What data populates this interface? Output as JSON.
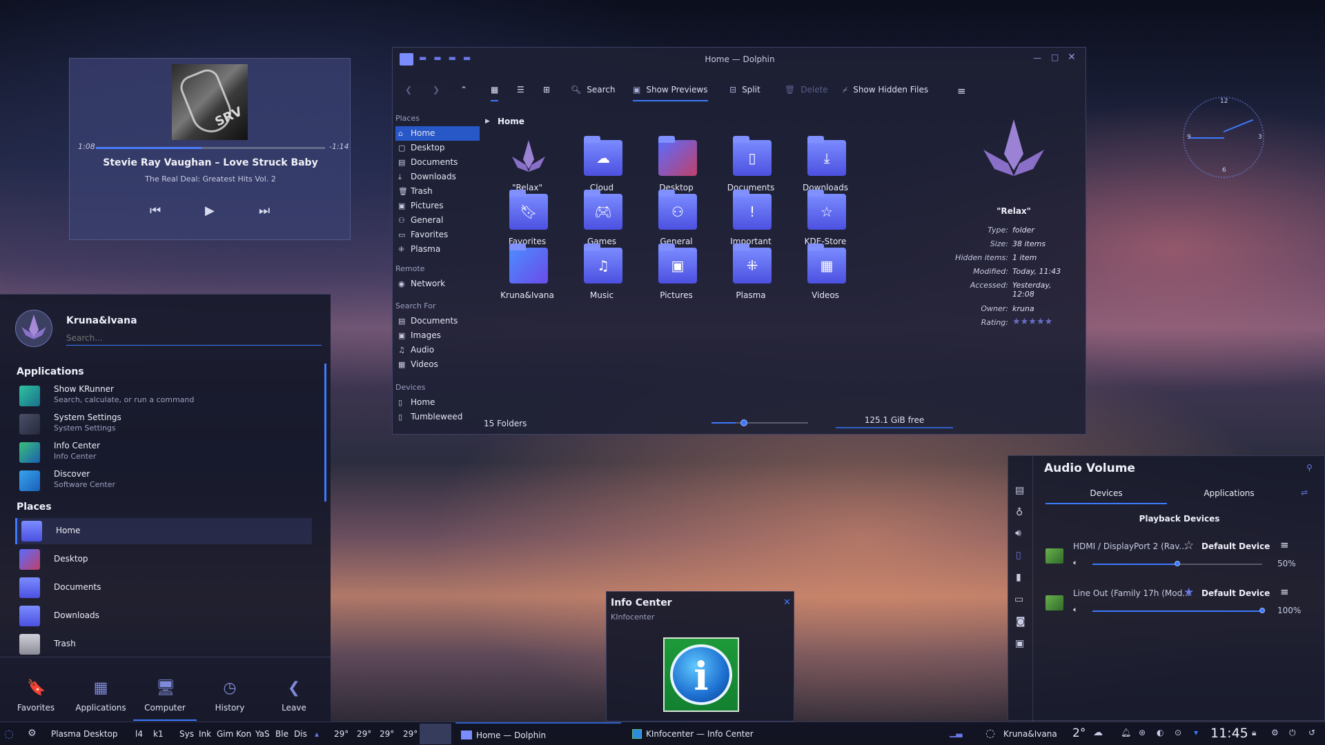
{
  "media": {
    "elapsed": "1:08",
    "remaining": "-1:14",
    "progress": 0.46,
    "track": "Stevie Ray Vaughan – Love Struck Baby",
    "album": "The Real Deal: Greatest Hits Vol. 2",
    "cover_text": "SRV"
  },
  "kickoff": {
    "user": "Kruna&Ivana",
    "search_placeholder": "Search...",
    "applications_header": "Applications",
    "apps": [
      {
        "title": "Show KRunner",
        "subtitle": "Search, calculate, or run a command",
        "icon": "krunner-icon"
      },
      {
        "title": "System Settings",
        "subtitle": "System Settings",
        "icon": "settings-icon"
      },
      {
        "title": "Info Center",
        "subtitle": "Info Center",
        "icon": "info-icon"
      },
      {
        "title": "Discover",
        "subtitle": "Software Center",
        "icon": "discover-icon"
      }
    ],
    "places_header": "Places",
    "places": [
      {
        "title": "Home",
        "icon": "home-folder-icon"
      },
      {
        "title": "Desktop",
        "icon": "desktop-folder-icon"
      },
      {
        "title": "Documents",
        "icon": "documents-folder-icon"
      },
      {
        "title": "Downloads",
        "icon": "downloads-folder-icon"
      },
      {
        "title": "Trash",
        "icon": "trash-icon"
      }
    ],
    "tabs": [
      {
        "label": "Favorites",
        "icon": "bookmark-icon"
      },
      {
        "label": "Applications",
        "icon": "grid-icon"
      },
      {
        "label": "Computer",
        "icon": "computer-icon"
      },
      {
        "label": "History",
        "icon": "clock-icon"
      },
      {
        "label": "Leave",
        "icon": "back-icon"
      }
    ]
  },
  "dolphin": {
    "title": "Home — Dolphin",
    "toolbar": {
      "search": "Search",
      "show_previews": "Show Previews",
      "split": "Split",
      "delete": "Delete",
      "show_hidden": "Show Hidden Files"
    },
    "breadcrumb": "Home",
    "places_sections": {
      "places": "Places",
      "remote": "Remote",
      "search_for": "Search For",
      "devices": "Devices"
    },
    "places": [
      "Home",
      "Desktop",
      "Documents",
      "Downloads",
      "Trash",
      "Pictures",
      "General",
      "Favorites",
      "Plasma"
    ],
    "remote": [
      "Network"
    ],
    "search_for": [
      "Documents",
      "Images",
      "Audio",
      "Videos"
    ],
    "devices": [
      "Home",
      "Tumbleweed"
    ],
    "items": [
      {
        "name": "\"Relax\"",
        "icon": "plasma-logo-icon"
      },
      {
        "name": "Cloud",
        "icon": "cloud-icon"
      },
      {
        "name": "Desktop",
        "icon": "desktop-icon"
      },
      {
        "name": "Documents",
        "icon": "document-icon"
      },
      {
        "name": "Downloads",
        "icon": "download-icon"
      },
      {
        "name": "Favorites",
        "icon": "bookmark-icon"
      },
      {
        "name": "Games",
        "icon": "gamepad-icon"
      },
      {
        "name": "General",
        "icon": "users-icon"
      },
      {
        "name": "Important",
        "icon": "exclamation-icon"
      },
      {
        "name": "KDE-Store",
        "icon": "star-icon"
      },
      {
        "name": "Kruna&Ivana",
        "icon": "folder-icon"
      },
      {
        "name": "Music",
        "icon": "music-icon"
      },
      {
        "name": "Pictures",
        "icon": "picture-icon"
      },
      {
        "name": "Plasma",
        "icon": "plasma-icon"
      },
      {
        "name": "Videos",
        "icon": "film-icon"
      }
    ],
    "info": {
      "name": "\"Relax\"",
      "rows": [
        {
          "k": "Type:",
          "v": "folder"
        },
        {
          "k": "Size:",
          "v": "38 items"
        },
        {
          "k": "Hidden items:",
          "v": "1 item"
        },
        {
          "k": "Modified:",
          "v": "Today, 11:43"
        },
        {
          "k": "Accessed:",
          "v": "Yesterday, 12:08"
        },
        {
          "k": "Owner:",
          "v": "kruna"
        },
        {
          "k": "Rating:",
          "v": "★★★★★"
        }
      ]
    },
    "status_count": "15 Folders",
    "free_space": "125.1 GiB free",
    "zoom": 0.25
  },
  "audio": {
    "title": "Audio Volume",
    "tab_devices": "Devices",
    "tab_applications": "Applications",
    "section": "Playback Devices",
    "devices": [
      {
        "name": "HDMI / DisplayPort 2 (Rav...",
        "default_label": "Default Device",
        "volume": "50%",
        "level": 0.5
      },
      {
        "name": "Line Out (Family 17h (Mod...",
        "default_label": "Default Device",
        "volume": "100%",
        "level": 1.0
      }
    ]
  },
  "infopop": {
    "title": "Info Center",
    "subtitle": "KInfocenter"
  },
  "clock": {
    "n12": "12",
    "n3": "3",
    "n6": "6",
    "n9": "9"
  },
  "taskbar": {
    "activity": "Plasma Desktop",
    "pager": [
      "l4",
      "k1"
    ],
    "quicklaunch": [
      "Sys",
      "Ink",
      "Gim",
      "Kon",
      "YaS",
      "Ble",
      "Dis"
    ],
    "temps": [
      "29°",
      "29°",
      "29°",
      "29°"
    ],
    "task1": "Home — Dolphin",
    "task2": "KInfocenter — Info Center",
    "user": "Kruna&Ivana",
    "weather": "2°",
    "time": "11:45"
  }
}
